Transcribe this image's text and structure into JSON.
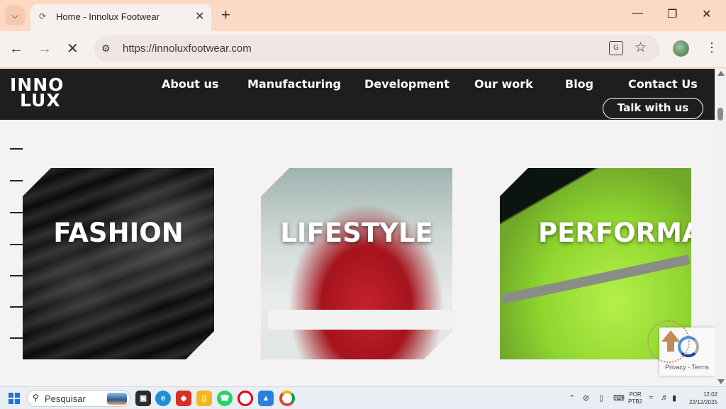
{
  "browser": {
    "tab": {
      "title": "Home - Innolux Footwear"
    },
    "address": {
      "url": "https://innoluxfootwear.com"
    }
  },
  "site": {
    "logo": {
      "line1": "INNO",
      "line2": "LUX"
    },
    "nav": [
      {
        "label": "About us"
      },
      {
        "label": "Manufacturing"
      },
      {
        "label": "Development"
      },
      {
        "label": "Our work"
      },
      {
        "label": "Blog"
      },
      {
        "label": "Contact Us"
      }
    ],
    "cta": "Talk with us",
    "cards": [
      {
        "title": "FASHION"
      },
      {
        "title": "LIFESTYLE"
      },
      {
        "title": "PERFORMANCE"
      }
    ],
    "recaptcha": "Privacy - Terms"
  },
  "taskbar": {
    "search_placeholder": "Pesquisar",
    "lang": {
      "line1": "POR",
      "line2": "PTB2"
    },
    "time": "12:02",
    "date": "22/12/2025"
  },
  "colors": {
    "header_bg": "#1e1e1e",
    "tabstrip_bg": "#fbd9c4",
    "page_bg": "#f5f2f4",
    "performance_green": "#9ee53a",
    "lifestyle_red": "#b5202a"
  }
}
